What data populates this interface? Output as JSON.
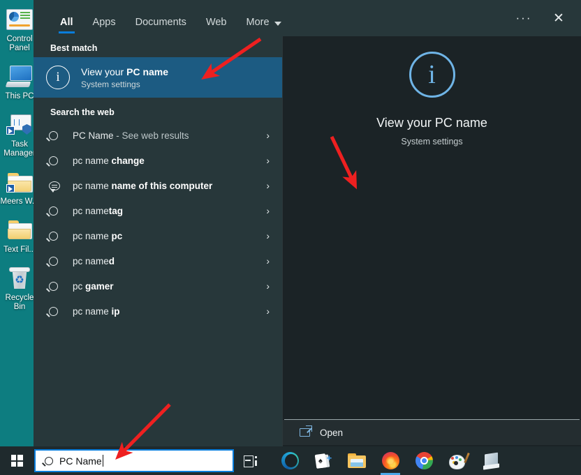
{
  "desktop": {
    "background_color": "#0d7d80",
    "icons": [
      {
        "label": "Control Panel",
        "icon": "control-panel-icon"
      },
      {
        "label": "This PC",
        "icon": "this-pc-icon"
      },
      {
        "label": "Task Manager",
        "icon": "task-manager-icon"
      },
      {
        "label": "Meers W...",
        "icon": "folder-shortcut-icon"
      },
      {
        "label": "Text Fil...",
        "icon": "folder-icon"
      },
      {
        "label": "Recycle Bin",
        "icon": "recycle-bin-icon"
      }
    ]
  },
  "search_panel": {
    "background_color": "#27373a",
    "accent_color": "#0a7ddb",
    "tabs": [
      {
        "label": "All",
        "active": true
      },
      {
        "label": "Apps",
        "active": false
      },
      {
        "label": "Documents",
        "active": false
      },
      {
        "label": "Web",
        "active": false
      },
      {
        "label": "More",
        "active": false,
        "has_caret": true
      }
    ],
    "window_controls": {
      "more_options": "···",
      "close": "✕"
    },
    "best_match": {
      "heading": "Best match",
      "icon": "info-icon",
      "icon_glyph": "i",
      "title_prefix": "View your ",
      "title_bold": "PC name",
      "subtitle": "System settings",
      "highlight_color": "#1c5b82"
    },
    "web_section": {
      "heading": "Search the web",
      "suggestions": [
        {
          "icon": "search-icon",
          "prefix": "PC Name",
          "bold": "",
          "suffix": " - See web results",
          "chevron": "›"
        },
        {
          "icon": "search-icon",
          "prefix": "pc name ",
          "bold": "change",
          "suffix": "",
          "chevron": "›"
        },
        {
          "icon": "speech-bubble-icon",
          "prefix": "pc name ",
          "bold": "name of this computer",
          "suffix": "",
          "chevron": "›"
        },
        {
          "icon": "search-icon",
          "prefix": "pc name",
          "bold": "tag",
          "suffix": "",
          "chevron": "›"
        },
        {
          "icon": "search-icon",
          "prefix": "pc name ",
          "bold": "pc",
          "suffix": "",
          "chevron": "›"
        },
        {
          "icon": "search-icon",
          "prefix": "pc name",
          "bold": "d",
          "suffix": "",
          "chevron": "›"
        },
        {
          "icon": "search-icon",
          "prefix": "pc ",
          "bold": "gamer",
          "suffix": "",
          "chevron": "›"
        },
        {
          "icon": "search-icon",
          "prefix": "pc name ",
          "bold": "ip",
          "suffix": "",
          "chevron": "›"
        }
      ]
    },
    "preview": {
      "background_color": "#1b2326",
      "icon": "info-icon",
      "icon_glyph": "i",
      "icon_color": "#6fb4e6",
      "title": "View your PC name",
      "subtitle": "System settings",
      "open_action": {
        "label": "Open",
        "icon": "open-external-icon"
      }
    }
  },
  "taskbar": {
    "background_color": "#1f2a2d",
    "start_button": "windows-logo-icon",
    "search": {
      "value": "PC Name",
      "icon": "search-icon",
      "border_color": "#0a7ddb"
    },
    "task_view": "task-view-icon",
    "apps": [
      {
        "name": "Microsoft Edge",
        "icon": "edge-icon",
        "running": false
      },
      {
        "name": "Solitaire",
        "icon": "cards-icon",
        "running": false
      },
      {
        "name": "File Explorer",
        "icon": "file-explorer-icon",
        "running": false
      },
      {
        "name": "Firefox",
        "icon": "firefox-icon",
        "running": true
      },
      {
        "name": "Google Chrome",
        "icon": "chrome-icon",
        "running": false
      },
      {
        "name": "Paint",
        "icon": "paint-icon",
        "running": false
      },
      {
        "name": "Notepad",
        "icon": "notepad-icon",
        "running": false
      }
    ]
  },
  "annotations": {
    "arrow_color": "#ee2020",
    "arrows": [
      {
        "name": "arrow-to-best-match",
        "points_at": "View your PC name"
      },
      {
        "name": "arrow-to-open-button",
        "points_at": "Open"
      },
      {
        "name": "arrow-to-search-box",
        "points_at": "PC Name search field"
      }
    ]
  }
}
